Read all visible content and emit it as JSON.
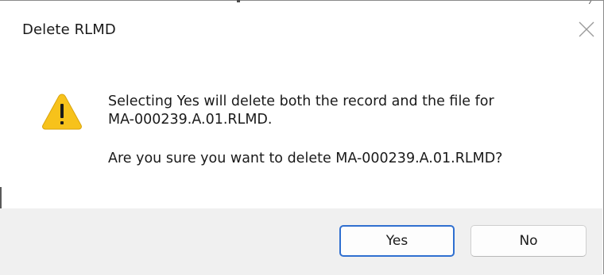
{
  "dialog": {
    "title": "Delete RLMD",
    "close_icon": "close-icon",
    "message_line1": "Selecting Yes will delete both the record and the file for",
    "message_line2": "MA-000239.A.01.RLMD.",
    "question": "Are you sure you want to delete MA-000239.A.01.RLMD?",
    "icon": "warning-icon",
    "buttons": {
      "yes_label": "Yes",
      "no_label": "No"
    }
  },
  "colors": {
    "accent": "#2f6fd0",
    "warning_fill": "#f7c21b",
    "footer_bg": "#f0f0f0"
  }
}
